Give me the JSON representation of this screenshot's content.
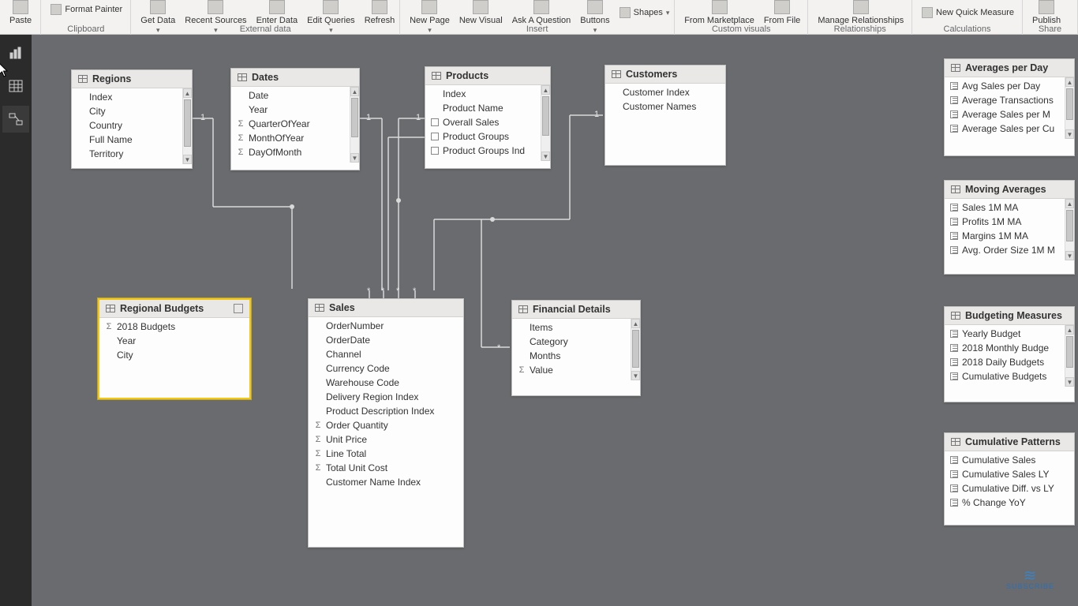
{
  "ribbon": {
    "paste": "Paste",
    "format_painter": "Format Painter",
    "get_data": "Get Data",
    "recent_sources": "Recent Sources",
    "enter_data": "Enter Data",
    "edit_queries": "Edit Queries",
    "refresh": "Refresh",
    "new_page": "New Page",
    "new_visual": "New Visual",
    "ask_a_question": "Ask A Question",
    "buttons": "Buttons",
    "shapes": "Shapes",
    "from_marketplace": "From Marketplace",
    "from_file": "From File",
    "manage_relationships": "Manage Relationships",
    "new_quick_measure": "New Quick Measure",
    "publish": "Publish",
    "groups": {
      "clipboard": "Clipboard",
      "external_data": "External data",
      "insert": "Insert",
      "custom_visuals": "Custom visuals",
      "relationships": "Relationships",
      "calculations": "Calculations",
      "share": "Share"
    }
  },
  "tables": {
    "regions": {
      "title": "Regions",
      "fields": [
        "Index",
        "City",
        "Country",
        "Full Name",
        "Territory"
      ]
    },
    "dates": {
      "title": "Dates",
      "fields": [
        {
          "name": "Date"
        },
        {
          "name": "Year"
        },
        {
          "name": "QuarterOfYear",
          "icon": "sigma"
        },
        {
          "name": "MonthOfYear",
          "icon": "sigma"
        },
        {
          "name": "DayOfMonth",
          "icon": "sigma"
        }
      ]
    },
    "products": {
      "title": "Products",
      "fields": [
        {
          "name": "Index"
        },
        {
          "name": "Product Name"
        },
        {
          "name": "Overall Sales",
          "icon": "calc"
        },
        {
          "name": "Product Groups",
          "icon": "calc"
        },
        {
          "name": "Product Groups Ind",
          "icon": "calc"
        }
      ]
    },
    "customers": {
      "title": "Customers",
      "fields": [
        "Customer Index",
        "Customer Names"
      ]
    },
    "regional_budgets": {
      "title": "Regional Budgets",
      "fields": [
        {
          "name": "2018 Budgets",
          "icon": "sigma"
        },
        {
          "name": "Year"
        },
        {
          "name": "City"
        }
      ]
    },
    "sales": {
      "title": "Sales",
      "fields": [
        {
          "name": "OrderNumber"
        },
        {
          "name": "OrderDate"
        },
        {
          "name": "Channel"
        },
        {
          "name": "Currency Code"
        },
        {
          "name": "Warehouse Code"
        },
        {
          "name": "Delivery Region Index"
        },
        {
          "name": "Product Description Index"
        },
        {
          "name": "Order Quantity",
          "icon": "sigma"
        },
        {
          "name": "Unit Price",
          "icon": "sigma"
        },
        {
          "name": "Line Total",
          "icon": "sigma"
        },
        {
          "name": "Total Unit Cost",
          "icon": "sigma"
        },
        {
          "name": "Customer Name Index"
        }
      ]
    },
    "financial_details": {
      "title": "Financial Details",
      "fields": [
        {
          "name": "Items"
        },
        {
          "name": "Category"
        },
        {
          "name": "Months"
        },
        {
          "name": "Value",
          "icon": "sigma"
        }
      ]
    },
    "averages_per_day": {
      "title": "Averages per Day",
      "fields": [
        {
          "name": "Avg Sales per Day",
          "icon": "measure"
        },
        {
          "name": "Average Transactions",
          "icon": "measure"
        },
        {
          "name": "Average Sales per M",
          "icon": "measure"
        },
        {
          "name": "Average Sales per Cu",
          "icon": "measure"
        }
      ]
    },
    "moving_averages": {
      "title": "Moving Averages",
      "fields": [
        {
          "name": "Sales 1M MA",
          "icon": "measure"
        },
        {
          "name": "Profits 1M MA",
          "icon": "measure"
        },
        {
          "name": "Margins 1M MA",
          "icon": "measure"
        },
        {
          "name": "Avg. Order Size 1M M",
          "icon": "measure"
        }
      ]
    },
    "budgeting_measures": {
      "title": "Budgeting Measures",
      "fields": [
        {
          "name": "Yearly Budget",
          "icon": "measure"
        },
        {
          "name": "2018 Monthly Budge",
          "icon": "measure"
        },
        {
          "name": "2018 Daily Budgets",
          "icon": "measure"
        },
        {
          "name": "Cumulative Budgets",
          "icon": "measure"
        }
      ]
    },
    "cumulative_patterns": {
      "title": "Cumulative Patterns",
      "fields": [
        {
          "name": "Cumulative Sales",
          "icon": "measure"
        },
        {
          "name": "Cumulative Sales LY",
          "icon": "measure"
        },
        {
          "name": "Cumulative Diff. vs LY",
          "icon": "measure"
        },
        {
          "name": "% Change YoY",
          "icon": "measure"
        }
      ]
    }
  },
  "relationships": {
    "one": "1",
    "many": "*"
  },
  "watermark": "SUBSCRIBE"
}
